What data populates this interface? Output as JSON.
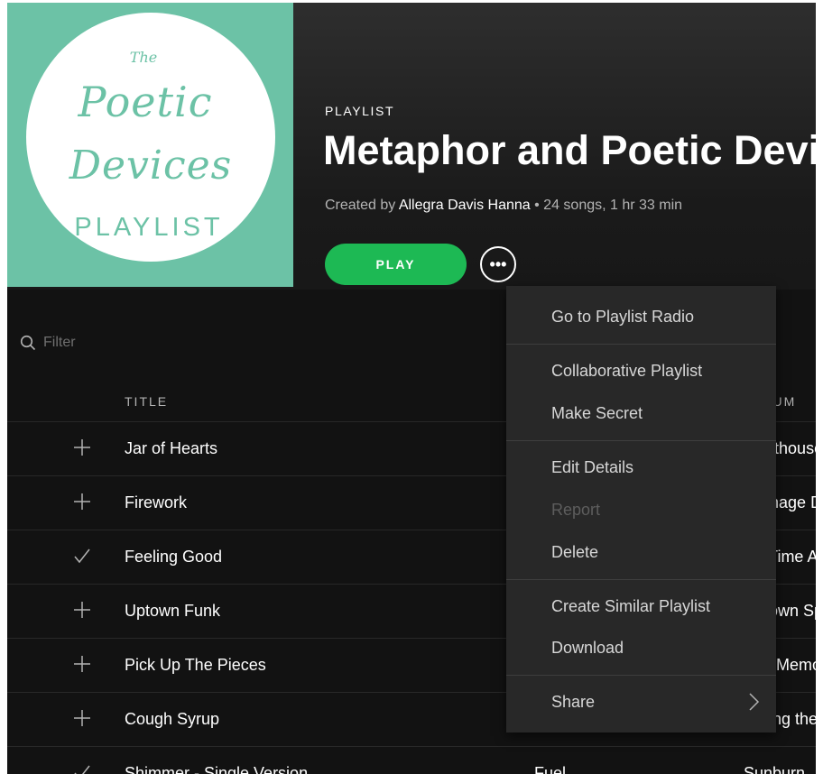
{
  "cover": {
    "line1": "The",
    "line2": "Poetic",
    "line3": "Devices",
    "line4": "PLAYLIST"
  },
  "header": {
    "type_label": "PLAYLIST",
    "title": "Metaphor and Poetic Devices",
    "created_by_prefix": "Created by",
    "creator": "Allegra Davis Hanna",
    "stats": " • 24 songs, 1 hr 33 min",
    "play_label": "PLAY",
    "more_label": "•••"
  },
  "filter": {
    "placeholder": "Filter"
  },
  "table": {
    "columns": {
      "title": "TITLE",
      "album": "ALBUM"
    },
    "rows": [
      {
        "action": "plus",
        "title": "Jar of Hearts",
        "artist": "",
        "album": "Lighthouse Astronomy"
      },
      {
        "action": "plus",
        "title": "Firework",
        "artist": "",
        "album": "Teenage Dream"
      },
      {
        "action": "check",
        "title": "Feeling Good",
        "artist": "",
        "album": "It's Time A Sunny"
      },
      {
        "action": "plus",
        "title": "Uptown Funk",
        "artist": "",
        "album": "Uptown Special"
      },
      {
        "action": "plus",
        "title": "Pick Up The Pieces",
        "artist": "",
        "album": "The Memories"
      },
      {
        "action": "plus",
        "title": "Cough Syrup",
        "artist": "",
        "album": "Taking the Long Way"
      },
      {
        "action": "check",
        "title": "Shimmer - Single Version",
        "artist": "Fuel",
        "album": "Sunburn"
      }
    ]
  },
  "context_menu": {
    "items": [
      {
        "label": "Go to Playlist Radio",
        "disabled": false
      },
      {
        "label": "Collaborative Playlist",
        "disabled": false
      },
      {
        "label": "Make Secret",
        "disabled": false
      },
      {
        "label": "Edit Details",
        "disabled": false
      },
      {
        "label": "Report",
        "disabled": true
      },
      {
        "label": "Delete",
        "disabled": false
      },
      {
        "label": "Create Similar Playlist",
        "disabled": false
      },
      {
        "label": "Download",
        "disabled": false
      },
      {
        "label": "Share",
        "disabled": false,
        "submenu": true
      }
    ]
  },
  "colors": {
    "accent_green": "#1db954",
    "cover_teal": "#6cc2a6",
    "menu_bg": "#282828",
    "background": "#121212"
  }
}
